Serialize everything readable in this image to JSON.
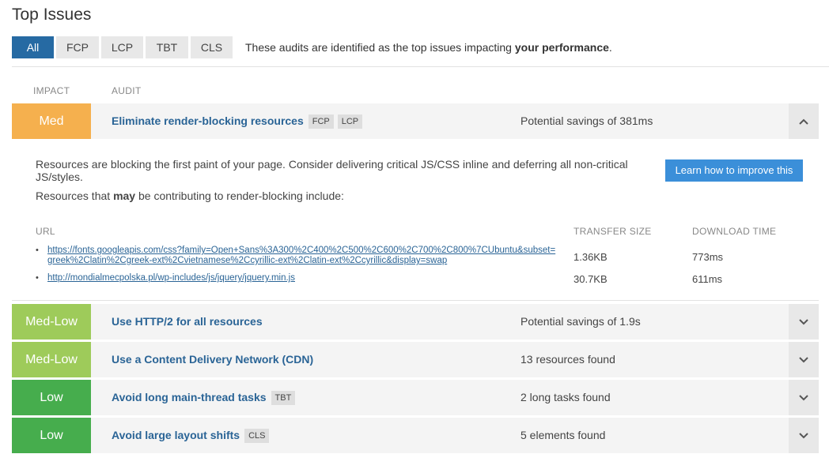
{
  "title": "Top Issues",
  "filters": {
    "items": [
      "All",
      "FCP",
      "LCP",
      "TBT",
      "CLS"
    ],
    "active": "All",
    "description_prefix": "These audits are identified as the top issues impacting ",
    "description_bold": "your performance",
    "description_suffix": "."
  },
  "columns": {
    "impact": "IMPACT",
    "audit": "AUDIT"
  },
  "colors": {
    "med": "#f5b04e",
    "med_low": "#9ecb5a",
    "low": "#46ad4d",
    "accent": "#266aa3",
    "link": "#2a6496"
  },
  "issues": [
    {
      "impact": "Med",
      "title": "Eliminate render-blocking resources",
      "tags": [
        "FCP",
        "LCP"
      ],
      "summary": "Potential savings of 381ms",
      "expanded": true
    },
    {
      "impact": "Med-Low",
      "title": "Use HTTP/2 for all resources",
      "tags": [],
      "summary": "Potential savings of 1.9s",
      "expanded": false
    },
    {
      "impact": "Med-Low",
      "title": "Use a Content Delivery Network (CDN)",
      "tags": [],
      "summary": "13 resources found",
      "expanded": false
    },
    {
      "impact": "Low",
      "title": "Avoid long main-thread tasks",
      "tags": [
        "TBT"
      ],
      "summary": "2 long tasks found",
      "expanded": false
    },
    {
      "impact": "Low",
      "title": "Avoid large layout shifts",
      "tags": [
        "CLS"
      ],
      "summary": "5 elements found",
      "expanded": false
    }
  ],
  "detail": {
    "description": "Resources are blocking the first paint of your page. Consider delivering critical JS/CSS inline and deferring all non-critical JS/styles.",
    "contributing_prefix": "Resources that ",
    "contributing_bold": "may",
    "contributing_suffix": " be contributing to render-blocking include:",
    "learn_button": "Learn how to improve this",
    "table_headers": {
      "url": "URL",
      "transfer_size": "TRANSFER SIZE",
      "download_time": "DOWNLOAD TIME"
    },
    "rows": [
      {
        "url": "https://fonts.googleapis.com/css?family=Open+Sans%3A300%2C400%2C500%2C600%2C700%2C800%7CUbuntu&subset=greek%2Clatin%2Cgreek-ext%2Cvietnamese%2Ccyrillic-ext%2Clatin-ext%2Ccyrillic&display=swap",
        "transfer_size": "1.36KB",
        "download_time": "773ms"
      },
      {
        "url": "http://mondialmecpolska.pl/wp-includes/js/jquery/jquery.min.js",
        "transfer_size": "30.7KB",
        "download_time": "611ms"
      }
    ]
  },
  "icons": {
    "expand": "chevron-down-icon",
    "collapse": "chevron-up-icon"
  }
}
